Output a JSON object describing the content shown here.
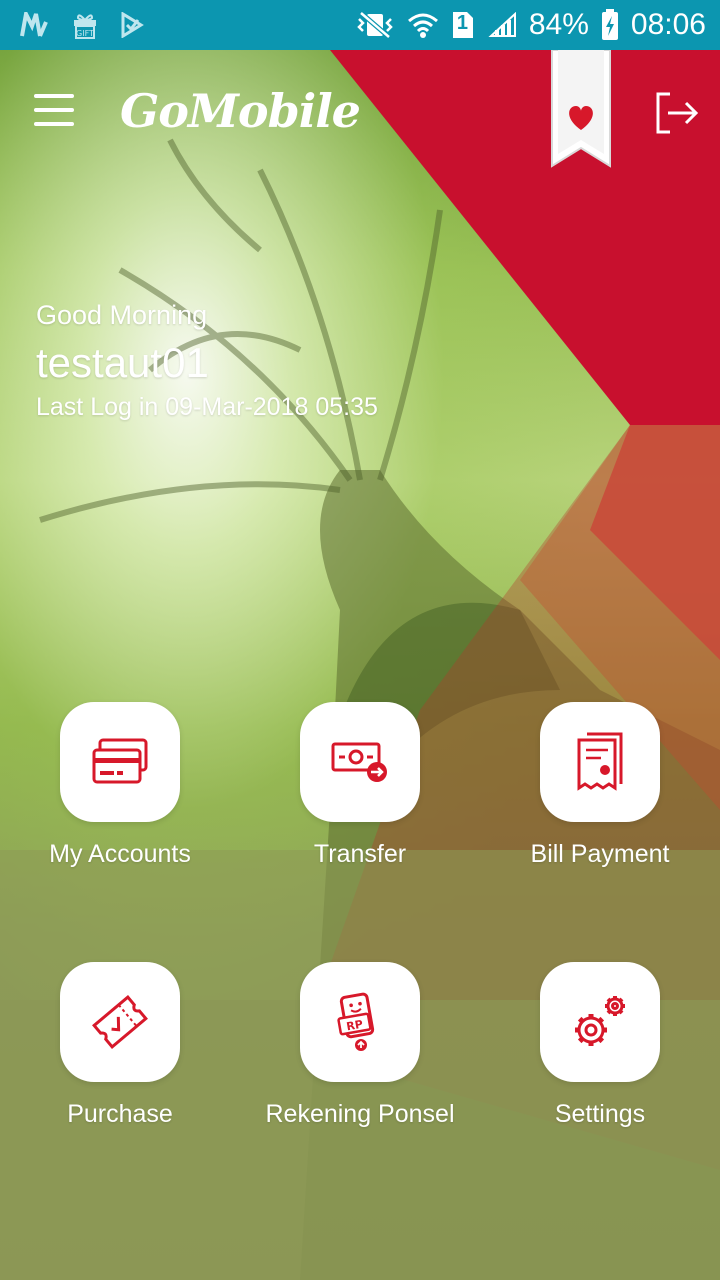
{
  "status_bar": {
    "battery": "84%",
    "time": "08:06",
    "sim_slot": "1",
    "left_icons": [
      "market-icon",
      "gift-icon",
      "play-store-icon"
    ],
    "right_icons": [
      "mute-vibrate-icon",
      "wifi-icon",
      "sim-icon",
      "signal-icon",
      "battery-charging-icon"
    ]
  },
  "header": {
    "app_name": "GoMobile",
    "menu_icon": "hamburger-menu-icon",
    "favorite_icon": "heart-bookmark-icon",
    "logout_icon": "logout-icon"
  },
  "greeting": {
    "salutation": "Good Morning",
    "username": "testaut01",
    "last_login": "Last Log in 09-Mar-2018 05:35"
  },
  "menu": {
    "items": [
      {
        "label": "My Accounts",
        "icon": "cards-icon"
      },
      {
        "label": "Transfer",
        "icon": "money-transfer-icon"
      },
      {
        "label": "Bill Payment",
        "icon": "bill-icon"
      },
      {
        "label": "Purchase",
        "icon": "ticket-icon"
      },
      {
        "label": "Rekening Ponsel",
        "icon": "phone-wallet-icon"
      },
      {
        "label": "Settings",
        "icon": "gears-icon"
      }
    ]
  },
  "colors": {
    "status_bar": "#0c96b0",
    "brand_red": "#c8102e",
    "icon_red": "#d7182a"
  }
}
